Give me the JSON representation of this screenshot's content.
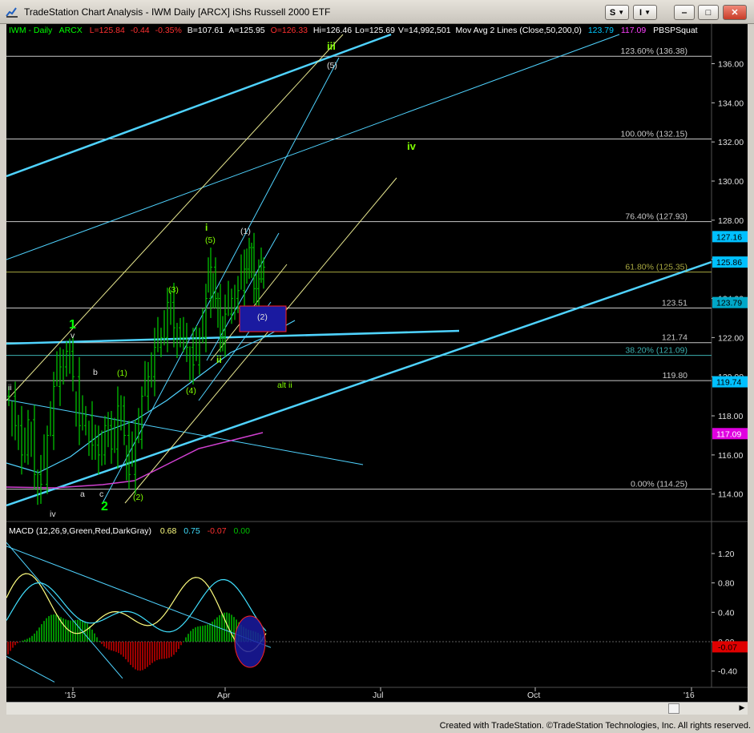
{
  "window": {
    "title": "TradeStation Chart Analysis - IWM Daily [ARCX] iShs Russell 2000 ETF",
    "buttons": {
      "s": "S",
      "i": "I",
      "min": "‒",
      "max": "□",
      "close": "✕"
    }
  },
  "header": {
    "symbol": "IWM - Daily",
    "exchange": "ARCX",
    "last": "L=125.84",
    "change": "-0.44",
    "change_pct": "-0.35%",
    "bid": "B=107.61",
    "ask": "A=125.95",
    "open": "O=126.33",
    "high": "Hi=126.46",
    "low": "Lo=125.69",
    "volume": "V=14,992,501",
    "ma_study": "Mov Avg 2 Lines (Close,50,200,0)",
    "ma1": "123.79",
    "ma2": "117.09",
    "pbs": "PBSPSquat"
  },
  "price_axis": {
    "ticks": [
      "136.00",
      "134.00",
      "132.00",
      "130.00",
      "128.00",
      "126.00",
      "124.00",
      "122.00",
      "120.00",
      "118.00",
      "116.00",
      "114.00"
    ]
  },
  "price_badges": {
    "last": "125.86",
    "high_mark": "127.16",
    "ma50": "123.79",
    "level": "119.74",
    "ma200": "117.09"
  },
  "fib_levels": [
    {
      "label": "123.60% (136.38)",
      "value": 136.38
    },
    {
      "label": "100.00% (132.15)",
      "value": 132.15
    },
    {
      "label": "76.40% (127.93)",
      "value": 127.93
    },
    {
      "label": "61.80% (125.35)",
      "value": 125.35
    },
    {
      "label": "123.51",
      "value": 123.51
    },
    {
      "label": "121.74",
      "value": 121.74
    },
    {
      "label": "38.20% (121.09)",
      "value": 121.09
    },
    {
      "label": "119.80",
      "value": 119.8
    },
    {
      "label": "0.00% (114.25)",
      "value": 114.25
    }
  ],
  "wave_labels": {
    "iii": "iii",
    "five_paren": "(5)",
    "iv": "iv",
    "i": "i",
    "five_i": "(5)",
    "one_paren": "(1)",
    "three": "(3)",
    "two_box": "(2)",
    "ii": "ii",
    "four": "(4)",
    "alt_ii": "alt ii",
    "one_big": "1",
    "v_small": "v",
    "b": "b",
    "one_small": "(1)",
    "a": "a",
    "c": "c",
    "two_big": "2",
    "two_paren": "(2)",
    "roman_ii": "ii",
    "roman_iv": "iv"
  },
  "macd": {
    "study": "MACD (12,26,9,Green,Red,DarkGray)",
    "v1": "0.68",
    "v2": "0.75",
    "v3": "-0.07",
    "v4": "0.00",
    "ticks": [
      "1.20",
      "0.80",
      "0.40",
      "0.00",
      "-0.40"
    ],
    "badge": "-0.07"
  },
  "time_axis": {
    "labels": [
      "'15",
      "Apr",
      "Jul",
      "Oct",
      "'16"
    ]
  },
  "footer": "Created with TradeStation. ©TradeStation Technologies, Inc. All rights reserved.",
  "colors": {
    "bars": "#00c000",
    "trend": "#4fd3ff",
    "fib": "#c8c8c8",
    "macd_line": "#ffff80",
    "signal": "#40e0ff",
    "badge_last": "#00c0ff",
    "badge_ma200": "#e000e0",
    "box": "#1a1aa0"
  }
}
